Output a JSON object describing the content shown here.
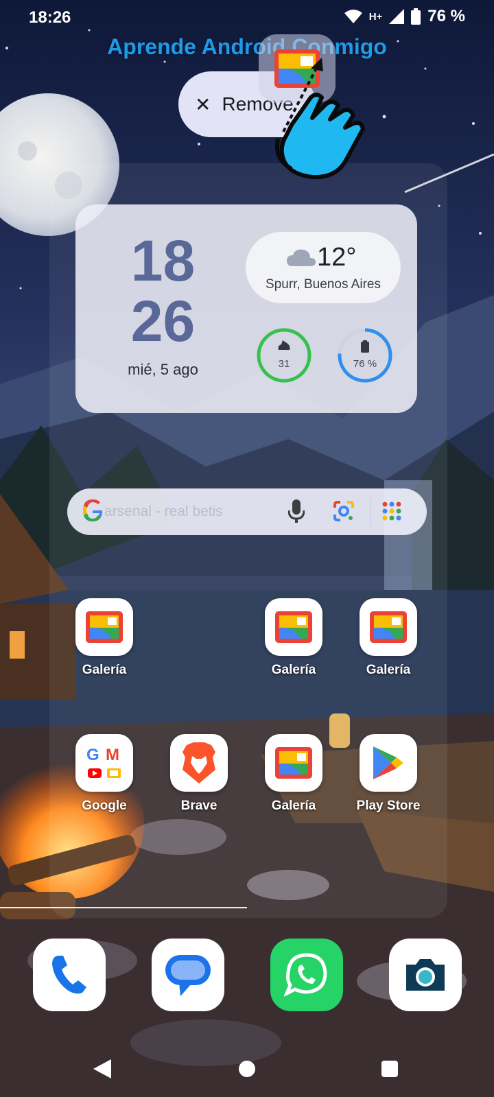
{
  "status_bar": {
    "time": "18:26",
    "network": "H+",
    "battery": "76 %"
  },
  "overlay": {
    "channel_title": "Aprende Android Conmigo",
    "remove_label": "Remove"
  },
  "widget": {
    "hour": "18",
    "minute": "26",
    "date": "mié, 5 ago",
    "weather_temp": "12°",
    "weather_location": "Spurr, Buenos Aires",
    "steps_value": "31",
    "battery_value": "76 %",
    "battery_level": 0.76,
    "colors": {
      "steps_ring": "#35c14a",
      "battery_ring": "#2d8ff0",
      "clock": "#5a6898"
    }
  },
  "search": {
    "placeholder": "arsenal - real betis"
  },
  "apps": {
    "row1": [
      {
        "label": "Galería",
        "icon": "gallery-icon"
      },
      {
        "label": "Galería",
        "icon": "gallery-icon"
      },
      {
        "label": "Galería",
        "icon": "gallery-icon"
      }
    ],
    "row2": [
      {
        "label": "Google",
        "icon": "google-folder-icon"
      },
      {
        "label": "Brave",
        "icon": "brave-icon"
      },
      {
        "label": "Galería",
        "icon": "gallery-icon"
      },
      {
        "label": "Play Store",
        "icon": "play-store-icon"
      }
    ]
  },
  "dock": [
    {
      "icon": "phone-icon"
    },
    {
      "icon": "messages-icon"
    },
    {
      "icon": "whatsapp-icon"
    },
    {
      "icon": "camera-icon"
    }
  ]
}
